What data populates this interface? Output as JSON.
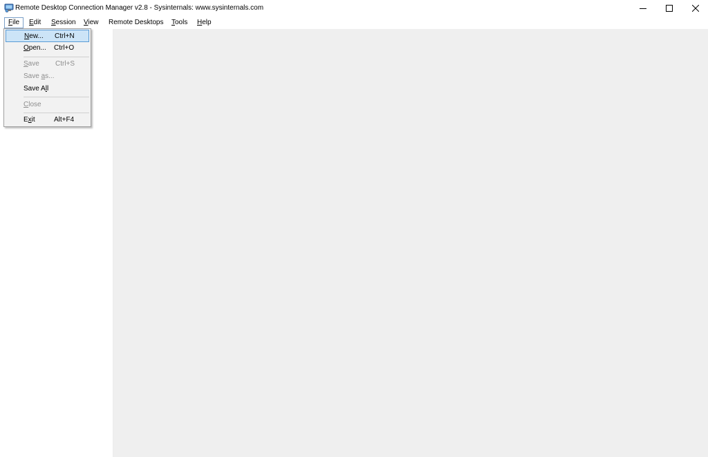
{
  "window": {
    "title": "Remote Desktop Connection Manager v2.8 - Sysinternals: www.sysinternals.com",
    "icon": "rdcman-app-icon",
    "controls": {
      "minimize": "minimize-icon",
      "maximize": "maximize-icon",
      "close": "close-icon"
    }
  },
  "menubar": {
    "items": [
      {
        "key": "F",
        "rest": "ile",
        "name": "File"
      },
      {
        "key": "E",
        "rest": "dit",
        "name": "Edit"
      },
      {
        "key": "S",
        "rest": "ession",
        "name": "Session"
      },
      {
        "key": "V",
        "rest": "iew",
        "name": "View"
      },
      {
        "key": "",
        "rest": "Remote Desktops",
        "name": "Remote Desktops"
      },
      {
        "key": "T",
        "rest": "ools",
        "name": "Tools"
      },
      {
        "key": "H",
        "rest": "elp",
        "name": "Help"
      }
    ],
    "open_menu": "File"
  },
  "file_menu": {
    "items": [
      {
        "pre": "",
        "key": "N",
        "post": "ew...",
        "shortcut": "Ctrl+N",
        "enabled": true,
        "highlighted": true
      },
      {
        "pre": "",
        "key": "O",
        "post": "pen...",
        "shortcut": "Ctrl+O",
        "enabled": true,
        "highlighted": false
      },
      {
        "pre": "",
        "key": "S",
        "post": "ave",
        "shortcut": "Ctrl+S",
        "enabled": false,
        "highlighted": false
      },
      {
        "pre": "Save ",
        "key": "a",
        "post": "s...",
        "shortcut": "",
        "enabled": false,
        "highlighted": false
      },
      {
        "pre": "Save A",
        "key": "l",
        "post": "l",
        "shortcut": "",
        "enabled": true,
        "highlighted": false
      },
      {
        "pre": "",
        "key": "C",
        "post": "lose",
        "shortcut": "",
        "enabled": false,
        "highlighted": false
      },
      {
        "pre": "E",
        "key": "x",
        "post": "it",
        "shortcut": "Alt+F4",
        "enabled": true,
        "highlighted": false
      }
    ]
  },
  "colors": {
    "highlight_bg": "#cce4f7",
    "highlight_border": "#5a9bd5",
    "disabled_text": "#8d8d8d",
    "main_pane_bg": "#efefef"
  }
}
